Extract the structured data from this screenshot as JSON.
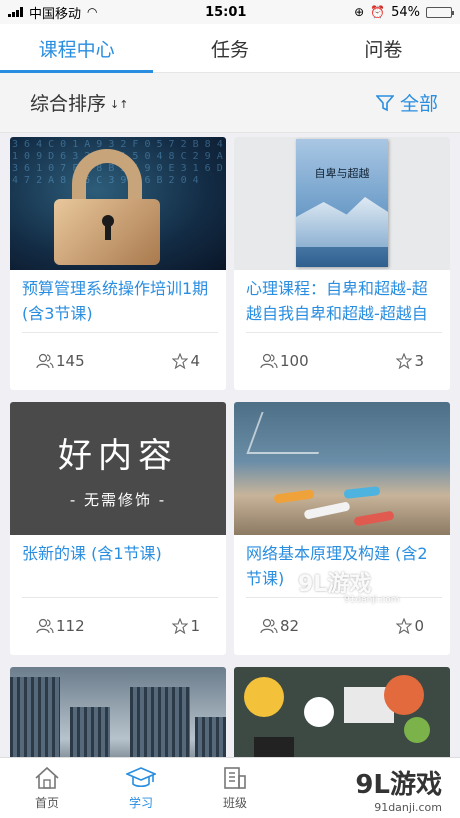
{
  "status_bar": {
    "carrier": "中国移动",
    "time": "15:01",
    "battery": "54%",
    "battery_level": 0.54
  },
  "tabs": [
    {
      "label": "课程中心",
      "active": true
    },
    {
      "label": "任务",
      "active": false
    },
    {
      "label": "问卷",
      "active": false
    }
  ],
  "sort_bar": {
    "sort_label": "综合排序",
    "filter_label": "全部"
  },
  "courses": [
    {
      "title": "预算管理系统操作培训1期 (含3节课)",
      "students": "145",
      "stars": "4",
      "thumb": "lock"
    },
    {
      "title": "心理课程：自卑和超越-超越自我自卑和超越-超越自",
      "students": "100",
      "stars": "3",
      "thumb": "book",
      "book_title": "自卑与超越"
    },
    {
      "title": "张新的课 (含1节课)",
      "students": "112",
      "stars": "1",
      "thumb": "good",
      "thumb_text": "好内容",
      "thumb_subtext": "- 无需修饰 -"
    },
    {
      "title": "网络基本原理及构建 (含2节课)",
      "students": "82",
      "stars": "0",
      "thumb": "class"
    }
  ],
  "watermark": {
    "text": "9L游戏",
    "url": "91danji.com"
  },
  "bottom_nav": [
    {
      "label": "首页",
      "icon": "home-icon",
      "active": false
    },
    {
      "label": "学习",
      "icon": "graduation-cap-icon",
      "active": true
    },
    {
      "label": "班级",
      "icon": "building-icon",
      "active": false
    }
  ],
  "brand": {
    "text": "9L游戏",
    "url": "91danji.com"
  },
  "colors": {
    "accent": "#2a8ee0"
  }
}
